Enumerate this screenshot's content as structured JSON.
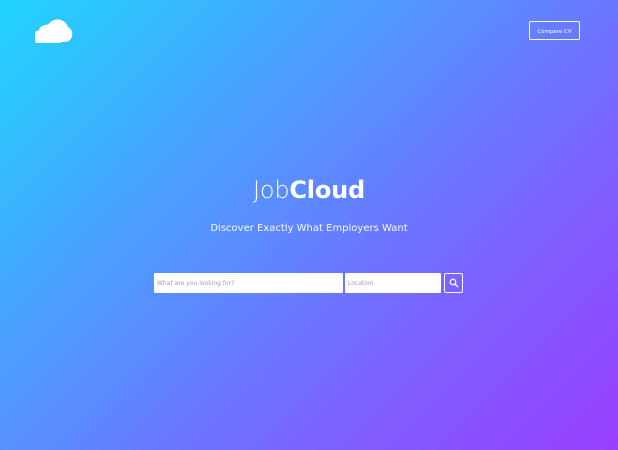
{
  "header": {
    "logo_icon": "cloud-icon",
    "compare_cv_label": "Compare CV"
  },
  "hero": {
    "brand_light": "Job",
    "brand_bold": "Cloud",
    "tagline": "Discover Exactly What Employers Want"
  },
  "search": {
    "query_placeholder": "What are you looking for?",
    "location_placeholder": "Location",
    "button_icon": "search-icon"
  },
  "colors": {
    "gradient_start": "#1fd5fe",
    "gradient_end": "#9a3fff",
    "text": "#ffffff"
  }
}
